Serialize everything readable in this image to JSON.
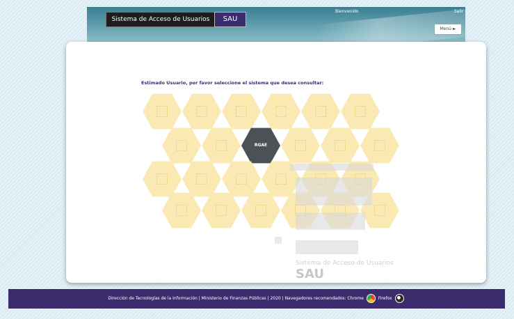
{
  "header": {
    "system_title": "Sistema de Acceso de Usuarios",
    "sau_label": "SAU",
    "welcome_text": "Bienvenido",
    "logout_label": "Salir",
    "menu_label": "Menú ►"
  },
  "main": {
    "prompt": "Estimado Usuario, por favor seleccione el sistema que desea consultar:",
    "active_system": "RGAE",
    "watermark_line1": "Sistema de Acceso de Usuarios",
    "watermark_sau": "SAU"
  },
  "footer": {
    "text": "Dirección de Tecnologías de la Información | Ministerio de Finanzas Públicas | 2020 | Navegadores recomendados: Chrome",
    "firefox_label": "Firefox"
  },
  "colors": {
    "brand_purple": "#3b2d6d",
    "hex_inactive": "#fbe9b3",
    "hex_active": "#4b5157"
  }
}
